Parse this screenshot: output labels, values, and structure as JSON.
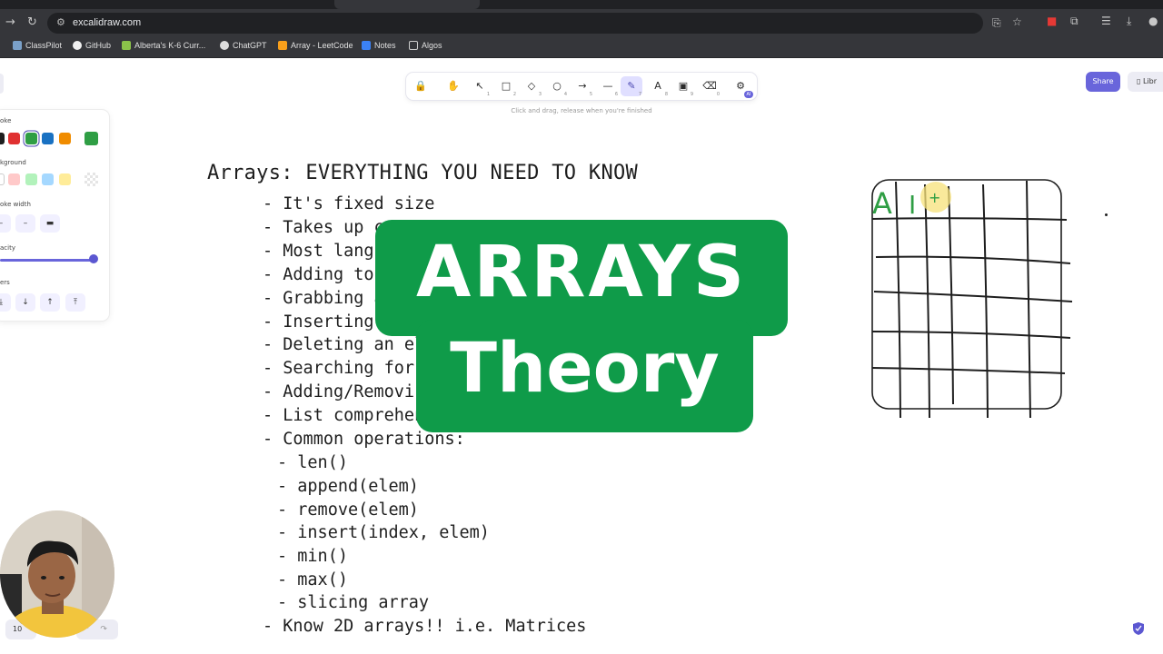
{
  "browser": {
    "url": "excalidraw.com",
    "bookmarks": [
      "ClassPilot",
      "GitHub",
      "Alberta's K-6 Curr...",
      "ChatGPT",
      "Array - LeetCode",
      "Notes",
      "Algos"
    ]
  },
  "excalidraw": {
    "toolbar": {
      "tools": [
        {
          "icon": "lock-icon",
          "glyph": "🔒",
          "key": ""
        },
        {
          "icon": "hand-icon",
          "glyph": "✋",
          "key": ""
        },
        {
          "icon": "selection-icon",
          "glyph": "↖",
          "key": "1"
        },
        {
          "icon": "rectangle-icon",
          "glyph": "□",
          "key": "2"
        },
        {
          "icon": "diamond-icon",
          "glyph": "◇",
          "key": "3"
        },
        {
          "icon": "ellipse-icon",
          "glyph": "○",
          "key": "4"
        },
        {
          "icon": "arrow-icon",
          "glyph": "→",
          "key": "5"
        },
        {
          "icon": "line-icon",
          "glyph": "—",
          "key": "6"
        },
        {
          "icon": "draw-icon",
          "glyph": "✎",
          "key": "7"
        },
        {
          "icon": "text-icon",
          "glyph": "A",
          "key": "8"
        },
        {
          "icon": "image-icon",
          "glyph": "▣",
          "key": "9"
        },
        {
          "icon": "eraser-icon",
          "glyph": "⌫",
          "key": "0"
        },
        {
          "icon": "library-icon",
          "glyph": "⚙",
          "key": ""
        }
      ],
      "active_tool": "draw",
      "hint": "Click and drag, release when you're finished"
    },
    "share_label": "Share",
    "library_label": "Libr",
    "properties": {
      "stroke_label": "oke",
      "stroke_colors": [
        "#1e1e1e",
        "#e03131",
        "#2f9e44",
        "#1971c2",
        "#f08c00"
      ],
      "current_stroke": "#2f9e44",
      "background_label": "kground",
      "background_colors": [
        "#ffffff",
        "#ffc9c9",
        "#b2f2bb",
        "#a5d8ff",
        "#ffec99"
      ],
      "stroke_width_label": "oke width",
      "opacity_label": "acity",
      "opacity_value": 100,
      "layers_label": "ers"
    },
    "notes": {
      "title": "Arrays: EVERYTHING YOU NEED TO KNOW",
      "items": [
        "- It's fixed size",
        "- Takes up co",
        "- Most langu",
        "- Adding to",
        "- Grabbing a",
        "- Inserting e",
        "- Deleting an ele",
        "- Searching for e",
        "- Adding/Removi",
        "- List comprehen",
        "- Common operations:"
      ],
      "sub_items": [
        "- len()",
        "- append(elem)",
        "- remove(elem)",
        "- insert(index, elem)",
        "- min()",
        "- max()",
        "- slicing array"
      ],
      "last_item": "- Know 2D arrays!! i.e. Matrices"
    },
    "grid_labels": [
      "A",
      "I"
    ],
    "bottom_zoom": "10"
  },
  "thumbnail": {
    "line1": "ARRAYS",
    "line2": "Theory",
    "color": "#0f9b49"
  }
}
